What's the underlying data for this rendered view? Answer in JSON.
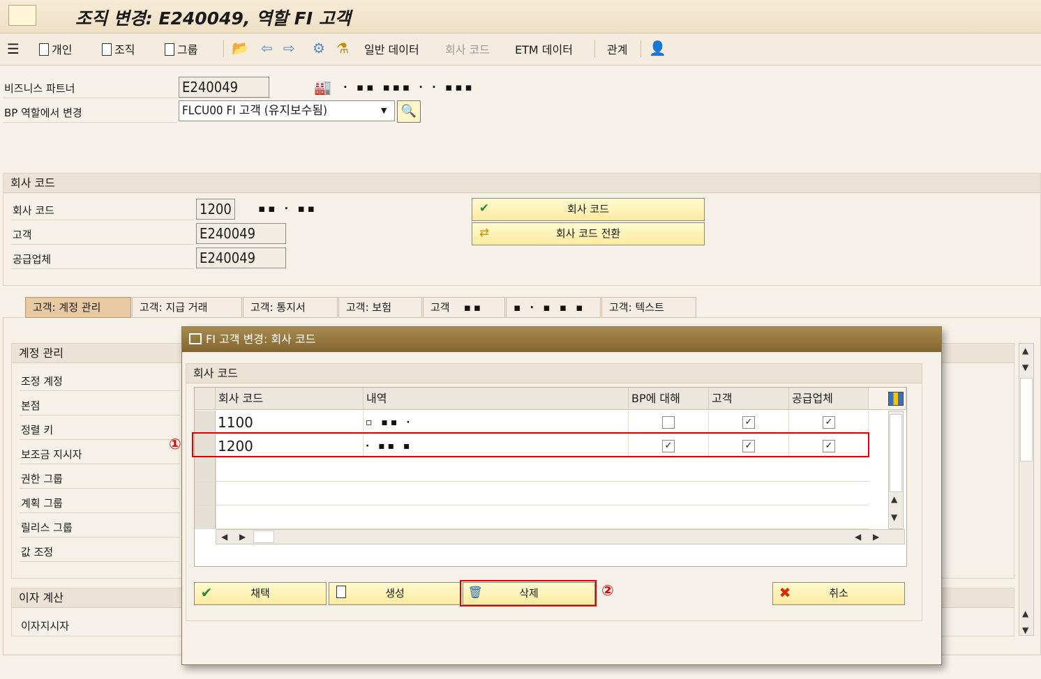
{
  "window": {
    "title": "조직 변경: E240049, 역할 FI 고객"
  },
  "toolbar": {
    "person": "개인",
    "org": "조직",
    "group": "그룹",
    "general_data": "일반 데이터",
    "company_code": "회사 코드",
    "etm_data": "ETM 데이터",
    "relationship": "관계"
  },
  "header": {
    "bp_label": "비즈니스 파트너",
    "bp_value": "E240049",
    "role_label": "BP 역할에서 변경",
    "role_value": "FLCU00 FI 고객 (유지보수됨)"
  },
  "company_section": {
    "title": "회사 코드",
    "code_label": "회사 코드",
    "code_value": "1200",
    "customer_label": "고객",
    "customer_value": "E240049",
    "vendor_label": "공급업체",
    "vendor_value": "E240049",
    "btn_company_code": "회사 코드",
    "btn_switch": "회사 코드 전환"
  },
  "tabs": [
    "고객: 계정 관리",
    "고객: 지급 거래",
    "고객: 통지서",
    "고객: 보험",
    "고객",
    "",
    "고객: 텍스트"
  ],
  "account_mgmt": {
    "title": "계정 관리",
    "fields": [
      "조정 계정",
      "본점",
      "정렬 키",
      "보조금 지시자",
      "권한 그룹",
      "계획 그룹",
      "릴리스 그룹",
      "값 조정"
    ]
  },
  "interest": {
    "title": "이자 계산",
    "field": "이자지시자"
  },
  "dialog": {
    "title": "FI 고객 변경: 회사 코드",
    "group_title": "회사 코드",
    "columns": [
      "회사 코드",
      "내역",
      "BP에 대해",
      "고객",
      "공급업체"
    ],
    "rows": [
      {
        "code": "1100",
        "bp": false,
        "customer": true,
        "vendor": true
      },
      {
        "code": "1200",
        "bp": true,
        "customer": true,
        "vendor": true
      }
    ],
    "buttons": {
      "adopt": "채택",
      "create": "생성",
      "delete": "삭제",
      "cancel": "취소"
    }
  },
  "annotations": {
    "marker1": "①",
    "marker2": "②"
  },
  "colors": {
    "highlight": "#e00000",
    "dialog_title": "#836630",
    "button_yellow": "#fbeaa0"
  }
}
